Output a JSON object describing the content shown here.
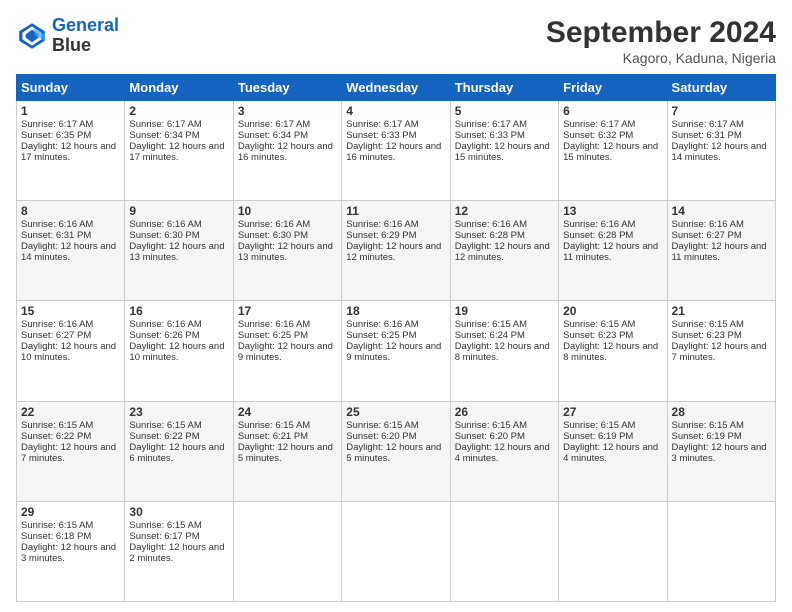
{
  "logo": {
    "line1": "General",
    "line2": "Blue"
  },
  "title": "September 2024",
  "subtitle": "Kagoro, Kaduna, Nigeria",
  "days_of_week": [
    "Sunday",
    "Monday",
    "Tuesday",
    "Wednesday",
    "Thursday",
    "Friday",
    "Saturday"
  ],
  "weeks": [
    [
      {
        "day": "1",
        "sunrise": "6:17 AM",
        "sunset": "6:35 PM",
        "daylight": "12 hours and 17 minutes."
      },
      {
        "day": "2",
        "sunrise": "6:17 AM",
        "sunset": "6:34 PM",
        "daylight": "12 hours and 17 minutes."
      },
      {
        "day": "3",
        "sunrise": "6:17 AM",
        "sunset": "6:34 PM",
        "daylight": "12 hours and 16 minutes."
      },
      {
        "day": "4",
        "sunrise": "6:17 AM",
        "sunset": "6:33 PM",
        "daylight": "12 hours and 16 minutes."
      },
      {
        "day": "5",
        "sunrise": "6:17 AM",
        "sunset": "6:33 PM",
        "daylight": "12 hours and 15 minutes."
      },
      {
        "day": "6",
        "sunrise": "6:17 AM",
        "sunset": "6:32 PM",
        "daylight": "12 hours and 15 minutes."
      },
      {
        "day": "7",
        "sunrise": "6:17 AM",
        "sunset": "6:31 PM",
        "daylight": "12 hours and 14 minutes."
      }
    ],
    [
      {
        "day": "8",
        "sunrise": "6:16 AM",
        "sunset": "6:31 PM",
        "daylight": "12 hours and 14 minutes."
      },
      {
        "day": "9",
        "sunrise": "6:16 AM",
        "sunset": "6:30 PM",
        "daylight": "12 hours and 13 minutes."
      },
      {
        "day": "10",
        "sunrise": "6:16 AM",
        "sunset": "6:30 PM",
        "daylight": "12 hours and 13 minutes."
      },
      {
        "day": "11",
        "sunrise": "6:16 AM",
        "sunset": "6:29 PM",
        "daylight": "12 hours and 12 minutes."
      },
      {
        "day": "12",
        "sunrise": "6:16 AM",
        "sunset": "6:28 PM",
        "daylight": "12 hours and 12 minutes."
      },
      {
        "day": "13",
        "sunrise": "6:16 AM",
        "sunset": "6:28 PM",
        "daylight": "12 hours and 11 minutes."
      },
      {
        "day": "14",
        "sunrise": "6:16 AM",
        "sunset": "6:27 PM",
        "daylight": "12 hours and 11 minutes."
      }
    ],
    [
      {
        "day": "15",
        "sunrise": "6:16 AM",
        "sunset": "6:27 PM",
        "daylight": "12 hours and 10 minutes."
      },
      {
        "day": "16",
        "sunrise": "6:16 AM",
        "sunset": "6:26 PM",
        "daylight": "12 hours and 10 minutes."
      },
      {
        "day": "17",
        "sunrise": "6:16 AM",
        "sunset": "6:25 PM",
        "daylight": "12 hours and 9 minutes."
      },
      {
        "day": "18",
        "sunrise": "6:16 AM",
        "sunset": "6:25 PM",
        "daylight": "12 hours and 9 minutes."
      },
      {
        "day": "19",
        "sunrise": "6:15 AM",
        "sunset": "6:24 PM",
        "daylight": "12 hours and 8 minutes."
      },
      {
        "day": "20",
        "sunrise": "6:15 AM",
        "sunset": "6:23 PM",
        "daylight": "12 hours and 8 minutes."
      },
      {
        "day": "21",
        "sunrise": "6:15 AM",
        "sunset": "6:23 PM",
        "daylight": "12 hours and 7 minutes."
      }
    ],
    [
      {
        "day": "22",
        "sunrise": "6:15 AM",
        "sunset": "6:22 PM",
        "daylight": "12 hours and 7 minutes."
      },
      {
        "day": "23",
        "sunrise": "6:15 AM",
        "sunset": "6:22 PM",
        "daylight": "12 hours and 6 minutes."
      },
      {
        "day": "24",
        "sunrise": "6:15 AM",
        "sunset": "6:21 PM",
        "daylight": "12 hours and 5 minutes."
      },
      {
        "day": "25",
        "sunrise": "6:15 AM",
        "sunset": "6:20 PM",
        "daylight": "12 hours and 5 minutes."
      },
      {
        "day": "26",
        "sunrise": "6:15 AM",
        "sunset": "6:20 PM",
        "daylight": "12 hours and 4 minutes."
      },
      {
        "day": "27",
        "sunrise": "6:15 AM",
        "sunset": "6:19 PM",
        "daylight": "12 hours and 4 minutes."
      },
      {
        "day": "28",
        "sunrise": "6:15 AM",
        "sunset": "6:19 PM",
        "daylight": "12 hours and 3 minutes."
      }
    ],
    [
      {
        "day": "29",
        "sunrise": "6:15 AM",
        "sunset": "6:18 PM",
        "daylight": "12 hours and 3 minutes."
      },
      {
        "day": "30",
        "sunrise": "6:15 AM",
        "sunset": "6:17 PM",
        "daylight": "12 hours and 2 minutes."
      },
      null,
      null,
      null,
      null,
      null
    ]
  ]
}
